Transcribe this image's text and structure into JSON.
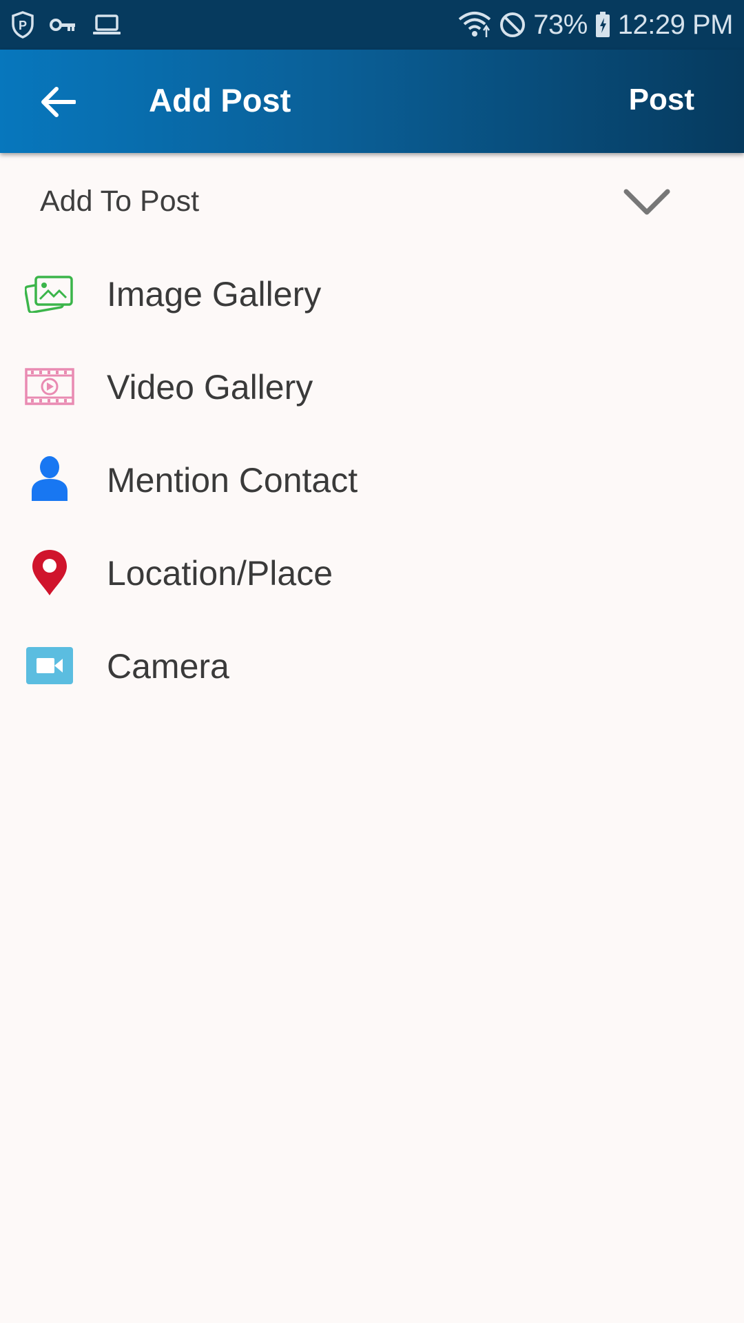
{
  "status_bar": {
    "battery": "73%",
    "time": "12:29 PM",
    "left_icons": [
      "vpn-shield-icon",
      "key-icon",
      "laptop-icon"
    ],
    "right_icons": [
      "wifi-icon",
      "do-not-disturb-icon",
      "battery-icon"
    ]
  },
  "app_bar": {
    "title": "Add Post",
    "action_label": "Post",
    "back_icon": "arrow-left-icon"
  },
  "section": {
    "label": "Add To Post",
    "icon": "chevron-down-icon"
  },
  "options": [
    {
      "label": "Image Gallery",
      "icon": "image-gallery-icon",
      "color": "#3bb54a"
    },
    {
      "label": "Video Gallery",
      "icon": "video-gallery-icon",
      "color": "#e98bb2"
    },
    {
      "label": "Mention Contact",
      "icon": "person-icon",
      "color": "#1877f2"
    },
    {
      "label": "Location/Place",
      "icon": "location-pin-icon",
      "color": "#d0142c"
    },
    {
      "label": "Camera",
      "icon": "camera-icon",
      "color": "#5bbde0"
    }
  ],
  "colors": {
    "app_bar_start": "#0777bd",
    "app_bar_end": "#063a5e",
    "status_bar": "#063a5e",
    "background": "#fdf9f8"
  }
}
